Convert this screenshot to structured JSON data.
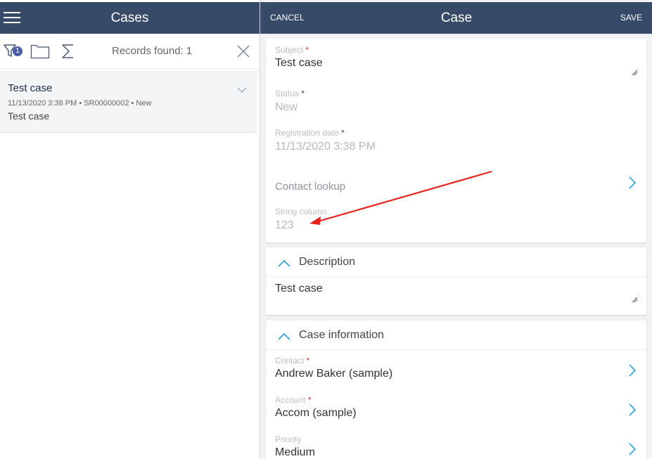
{
  "left_panel": {
    "title": "Cases",
    "filter_badge": "1",
    "records_found": "Records found: 1",
    "case_item": {
      "title": "Test case",
      "meta": "11/13/2020 3:38 PM • SR00000002 • New",
      "subject": "Test case"
    }
  },
  "right_panel": {
    "cancel_label": "CANCEL",
    "title": "Case",
    "save_label": "SAVE",
    "main_card": {
      "subject_label": "Subject",
      "subject_value": "Test case",
      "status_label": "Status",
      "status_value": "New",
      "registration_label": "Registration date",
      "registration_value": "11/13/2020 3:38 PM",
      "contact_lookup_label": "Contact lookup",
      "string_column_label": "String column",
      "string_column_value": "123"
    },
    "description": {
      "title": "Description",
      "value": "Test case"
    },
    "case_information": {
      "title": "Case information",
      "contact_label": "Contact",
      "contact_value": "Andrew Baker (sample)",
      "account_label": "Account",
      "account_value": "Accom (sample)",
      "priority_label": "Priority",
      "priority_value": "Medium"
    }
  },
  "icons": [
    "menu-icon",
    "filter-icon",
    "folder-icon",
    "sum-icon",
    "close-icon",
    "chevron-down-icon",
    "chevron-right-icon",
    "chevron-up-icon",
    "resize-icon"
  ],
  "colors": {
    "header_bg": "#374a68",
    "accent": "#2ea1d6",
    "required": "#e8332e",
    "annotation_arrow": "#e8201c"
  }
}
